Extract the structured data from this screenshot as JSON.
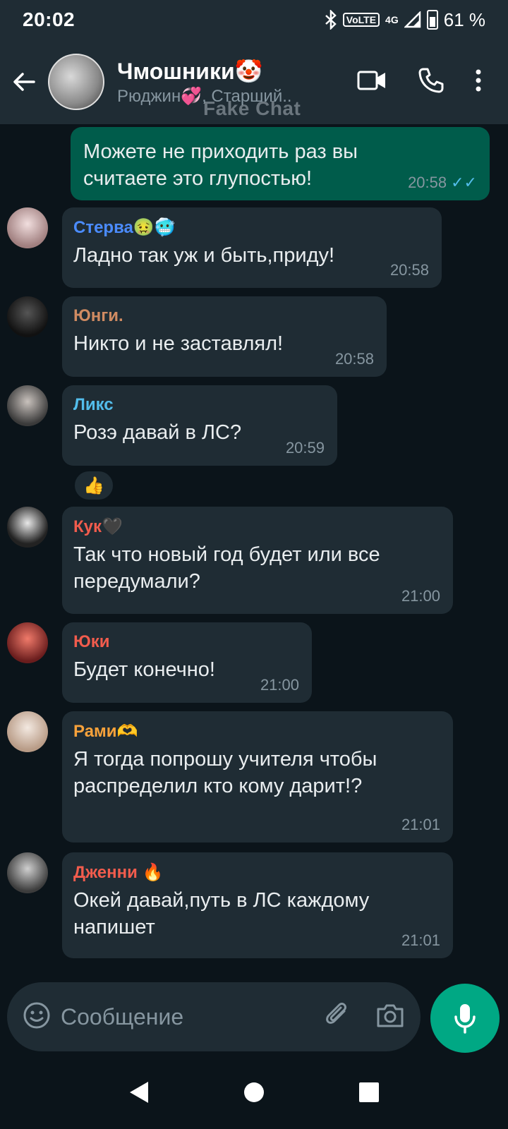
{
  "status_bar": {
    "time": "20:02",
    "battery": "61 %",
    "volte": "VoLTE",
    "network": "4G"
  },
  "header": {
    "title": "Чмошники🤡",
    "subtitle": "Рюджин💞, Старший..",
    "watermark": "Fake Chat"
  },
  "messages": [
    {
      "direction": "outgoing",
      "text": "Можете не приходить раз вы считаете это глупостью!",
      "time": "20:58",
      "status": "read"
    },
    {
      "sender": "Стерва🤢🥶",
      "sender_color": "#4b8cff",
      "text": "Ладно так уж и быть,приду!",
      "time": "20:58"
    },
    {
      "sender": "Юнги.",
      "sender_color": "#d08b62",
      "text": "Никто и не заставлял!",
      "time": "20:58"
    },
    {
      "sender": "Ликс",
      "sender_color": "#53bdeb",
      "text": "Розэ давай в ЛС?",
      "time": "20:59",
      "reaction": "👍"
    },
    {
      "sender": "Кук🖤",
      "sender_color": "#f15c4d",
      "text": "Так что новый год будет или все передумали?",
      "time": "21:00"
    },
    {
      "sender": "Юки",
      "sender_color": "#f15c4d",
      "text": "Будет конечно!",
      "time": "21:00"
    },
    {
      "sender": "Рами🫶",
      "sender_color": "#f7a23b",
      "text": "Я тогда попрошу учителя чтобы распределил кто кому дарит!?",
      "time": "21:01"
    },
    {
      "sender": "Дженни 🔥",
      "sender_color": "#f15c4d",
      "text": "Окей давай,путь в ЛС каждому напишет",
      "time": "21:01"
    }
  ],
  "composer": {
    "placeholder": "Сообщение"
  },
  "icons": {
    "back": "arrow-left-icon",
    "video": "video-call-icon",
    "call": "phone-icon",
    "menu": "more-vert-icon",
    "emoji": "emoji-icon",
    "attach": "paperclip-icon",
    "camera": "camera-icon",
    "mic": "mic-icon"
  },
  "colors": {
    "outgoing_bubble": "#005c4b",
    "incoming_bubble": "#1f2c34",
    "accent": "#00a884",
    "background": "#0b141a"
  }
}
